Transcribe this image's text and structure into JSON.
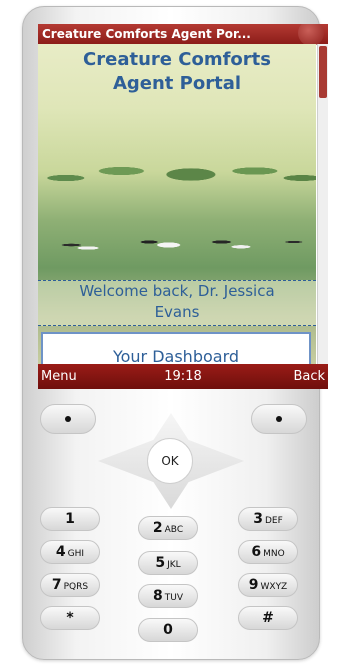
{
  "window": {
    "title": "Creature Comforts Agent Por..."
  },
  "content": {
    "heading": [
      "Creature Comforts",
      "Agent Portal"
    ],
    "welcome": [
      "Welcome back, Dr. Jessica",
      "Evans"
    ],
    "dashboard_button": "Your Dashboard"
  },
  "softkeys": {
    "left": "Menu",
    "time": "19:18",
    "right": "Back"
  },
  "keypad": {
    "ok": "OK",
    "keys": [
      {
        "num": "1",
        "letters": ""
      },
      {
        "num": "2",
        "letters": "ABC"
      },
      {
        "num": "3",
        "letters": "DEF"
      },
      {
        "num": "4",
        "letters": "GHI"
      },
      {
        "num": "5",
        "letters": "JKL"
      },
      {
        "num": "6",
        "letters": "MNO"
      },
      {
        "num": "7",
        "letters": "PQRS"
      },
      {
        "num": "8",
        "letters": "TUV"
      },
      {
        "num": "9",
        "letters": "WXYZ"
      },
      {
        "num": "*",
        "letters": ""
      },
      {
        "num": "0",
        "letters": ""
      },
      {
        "num": "#",
        "letters": ""
      }
    ]
  },
  "colors": {
    "accent": "#8c1d19",
    "link": "#2e5f98",
    "button_border": "#6f93c7"
  },
  "icons": {
    "soft_left_key": "dot-icon",
    "soft_right_key": "dot-icon"
  }
}
